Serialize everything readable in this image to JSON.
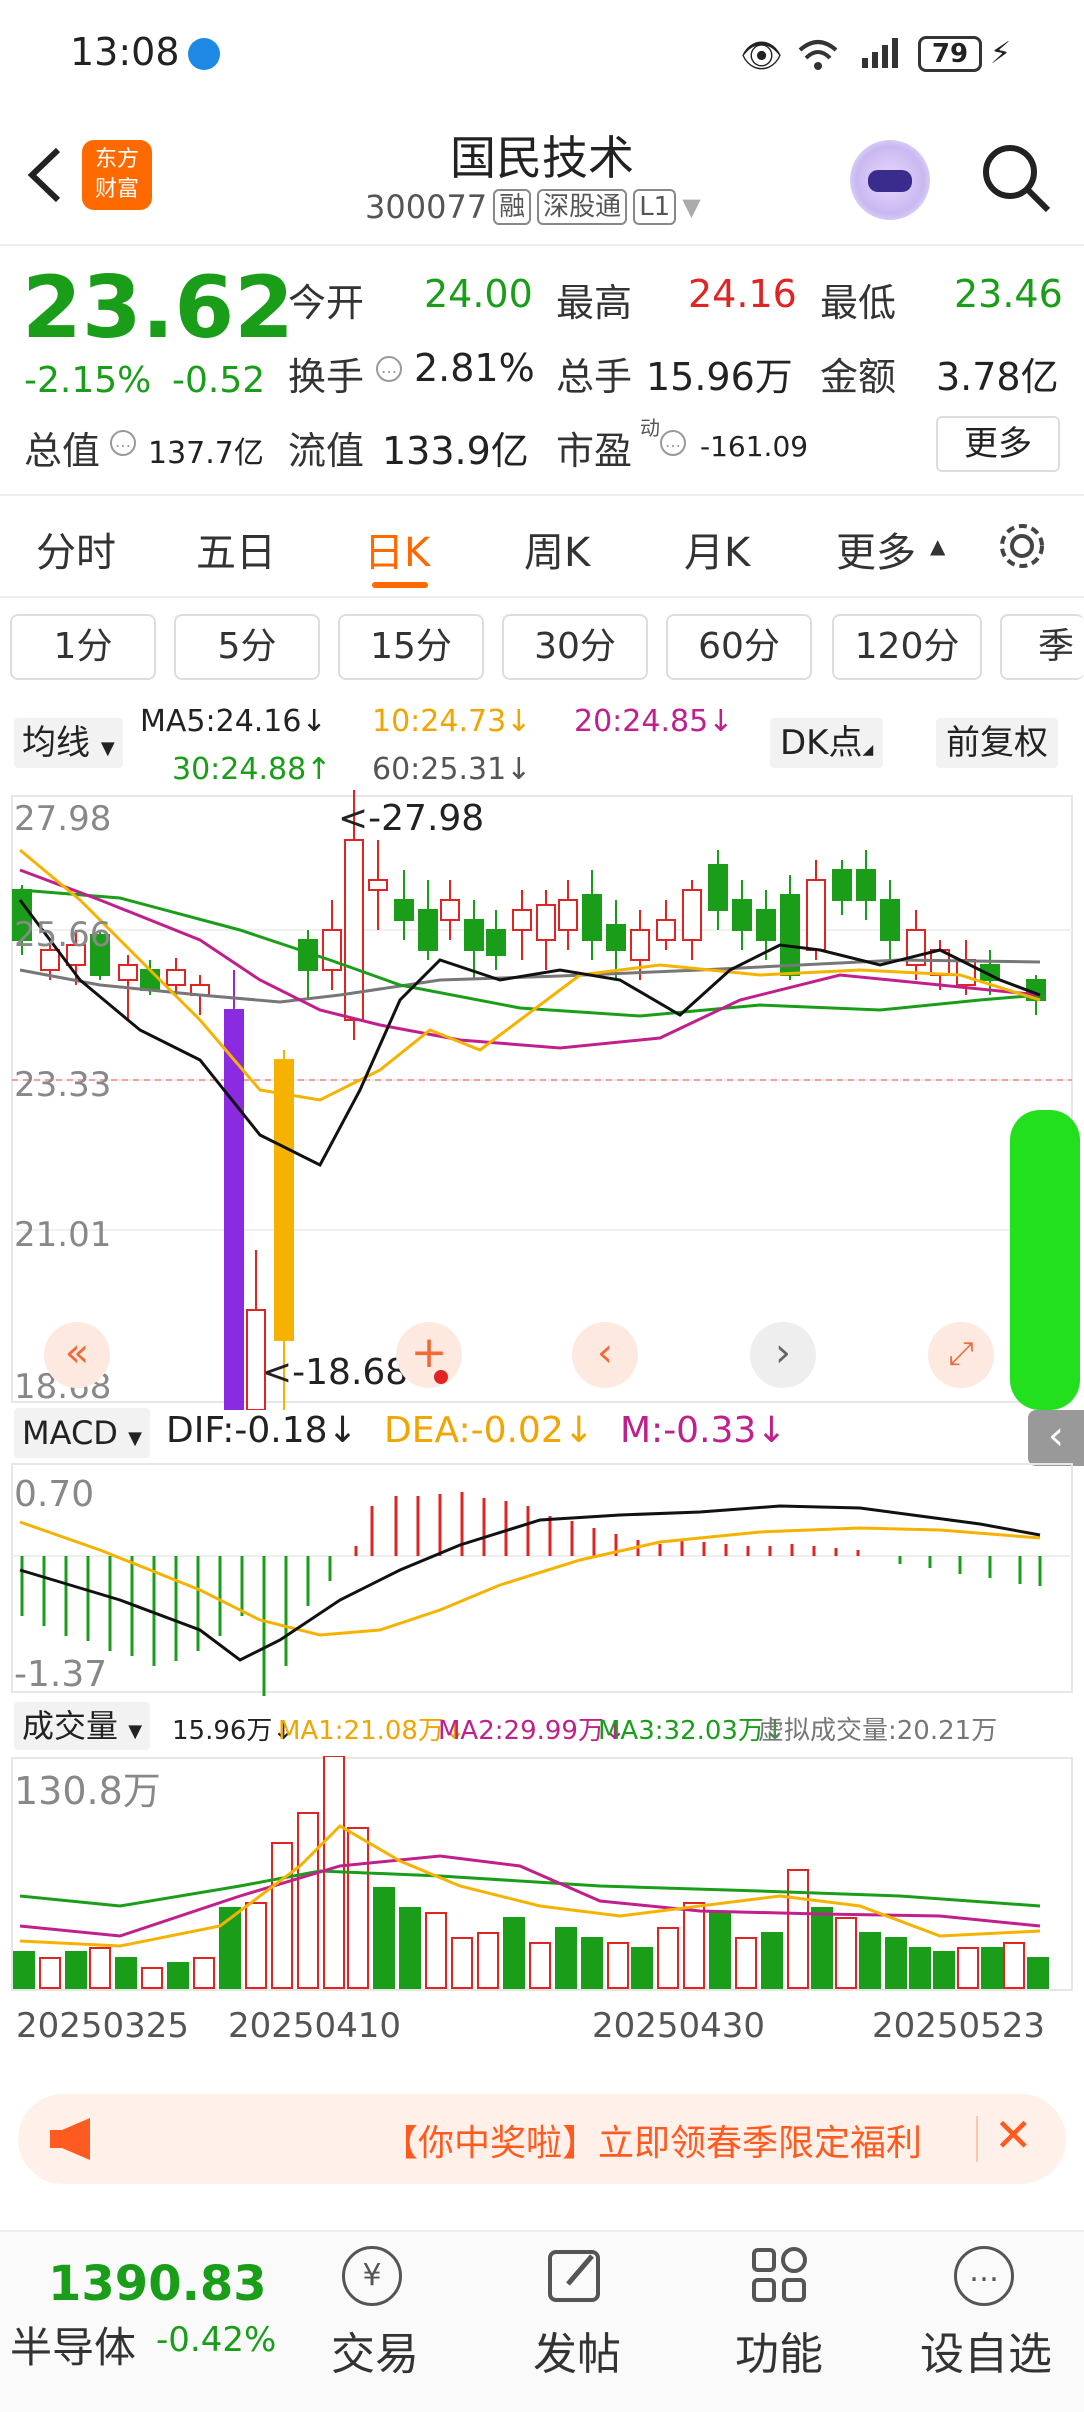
{
  "status_bar": {
    "time": "13:08",
    "battery": "79"
  },
  "header": {
    "app_logo_line1": "东方",
    "app_logo_line2": "财富",
    "title": "国民技术",
    "code": "300077",
    "tag_rong": "融",
    "tag_sgt": "深股通",
    "tag_level": "L1"
  },
  "quote": {
    "price": "23.62",
    "change_pct": "-2.15%",
    "change": "-0.52",
    "open_label": "今开",
    "open": "24.00",
    "high_label": "最高",
    "high": "24.16",
    "low_label": "最低",
    "low": "23.46",
    "turnover_label": "换手",
    "turnover": "2.81%",
    "volume_label": "总手",
    "volume": "15.96万",
    "amount_label": "金额",
    "amount": "3.78亿",
    "mktcap_label": "总值",
    "mktcap": "137.7亿",
    "float_label": "流值",
    "float": "133.9亿",
    "pe_label": "市盈",
    "pe_sup": "动",
    "pe": "-161.09",
    "more": "更多"
  },
  "tabs": [
    "分时",
    "五日",
    "日K",
    "周K",
    "月K",
    "更多"
  ],
  "active_tab": "日K",
  "periods": [
    "1分",
    "5分",
    "15分",
    "30分",
    "60分",
    "120分",
    "季"
  ],
  "ma": {
    "toggle": "均线",
    "ma5": "MA5:24.16↓",
    "ma10": "10:24.73↓",
    "ma20": "20:24.85↓",
    "ma30": "30:24.88↑",
    "ma60": "60:25.31↓",
    "dk": "DK点",
    "fq": "前复权"
  },
  "kline": {
    "y_labels": [
      "27.98",
      "25.66",
      "23.33",
      "21.01",
      "18.68"
    ],
    "max_label": "<-27.98",
    "min_label": "<-18.68"
  },
  "macd": {
    "toggle": "MACD",
    "dif": "DIF:-0.18↓",
    "dea": "DEA:-0.02↓",
    "m": "M:-0.33↓",
    "y_top": "0.70",
    "y_bottom": "-1.37"
  },
  "vol": {
    "toggle": "成交量",
    "v": "15.96万↓",
    "ma1": "MA1:21.08万↓",
    "ma2": "MA2:29.99万↓",
    "ma3": "MA3:32.03万↓",
    "virtual": "虚拟成交量:20.21万",
    "y_top": "130.8万"
  },
  "dates": [
    "20250325",
    "20250410",
    "20250430",
    "20250523"
  ],
  "banner": {
    "text": "【你中奖啦】立即领春季限定福利"
  },
  "bottom": {
    "index_value": "1390.83",
    "index_name": "半导体",
    "index_change": "-0.42%",
    "nav": [
      "交易",
      "发帖",
      "功能",
      "设自选"
    ]
  },
  "colors": {
    "up": "#e02424",
    "down": "#1a9e1a",
    "accent": "#ff6a00"
  }
}
